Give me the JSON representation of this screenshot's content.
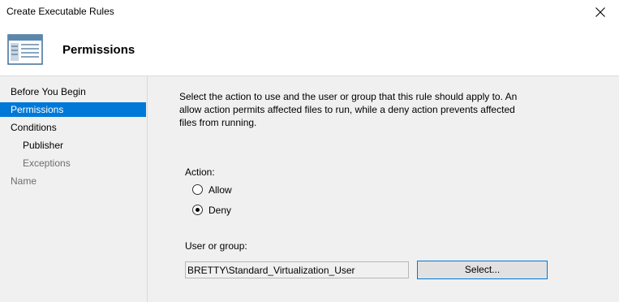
{
  "window": {
    "title": "Create Executable Rules"
  },
  "header": {
    "icon": "wizard-window-icon",
    "title": "Permissions"
  },
  "sidebar": {
    "items": [
      {
        "label": "Before You Begin",
        "state": "normal"
      },
      {
        "label": "Permissions",
        "state": "active"
      },
      {
        "label": "Conditions",
        "state": "normal"
      },
      {
        "label": "Publisher",
        "state": "normal"
      },
      {
        "label": "Exceptions",
        "state": "disabled"
      },
      {
        "label": "Name",
        "state": "disabled"
      }
    ]
  },
  "main": {
    "intro": "Select the action to use and the user or group that this rule should apply to. An allow action permits affected files to run, while a deny action prevents affected files from running.",
    "action_label": "Action:",
    "actions": [
      {
        "label": "Allow",
        "checked": false
      },
      {
        "label": "Deny",
        "checked": true
      }
    ],
    "user_group_label": "User or group:",
    "user_group_value": "BRETTY\\Standard_Virtualization_User",
    "select_button": "Select..."
  },
  "colors": {
    "accent": "#0078d7",
    "panel_bg": "#f0f0f0",
    "disabled_text": "#6d6d6d"
  }
}
